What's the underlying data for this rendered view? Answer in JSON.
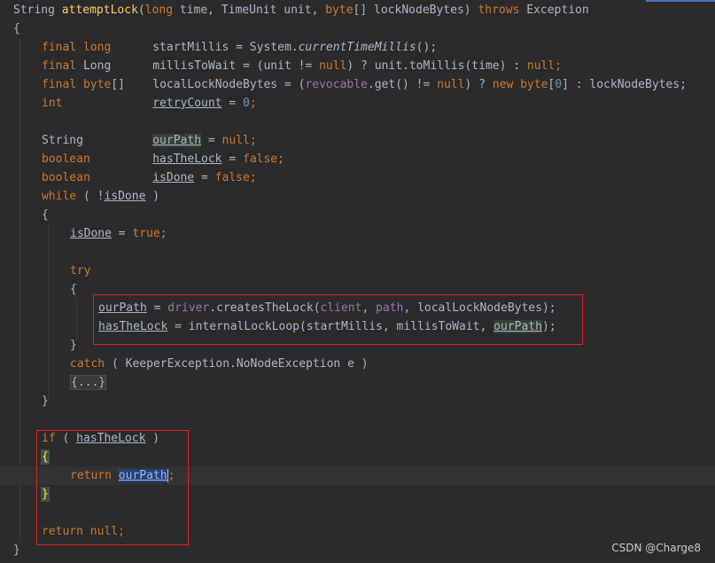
{
  "lines": [
    {
      "indent": 0,
      "tokens": [
        [
          "String ",
          "id"
        ],
        [
          "attemptLock",
          "fn"
        ],
        [
          "(",
          "id"
        ],
        [
          "long ",
          "kw"
        ],
        [
          "time, ",
          "id"
        ],
        [
          "TimeUnit unit, ",
          "id"
        ],
        [
          "byte",
          "kw"
        ],
        [
          "[] lockNodeBytes) ",
          "id"
        ],
        [
          "throws ",
          "kw"
        ],
        [
          "Exception",
          "id"
        ]
      ]
    },
    {
      "indent": 0,
      "tokens": [
        [
          "{",
          "id"
        ]
      ]
    },
    {
      "indent": 1,
      "tokens": [
        [
          "final long      ",
          "kw"
        ],
        [
          "startMillis = System.",
          "id"
        ],
        [
          "currentTimeMillis",
          "id italic"
        ],
        [
          "();",
          "id"
        ]
      ]
    },
    {
      "indent": 1,
      "tokens": [
        [
          "final ",
          "kw"
        ],
        [
          "Long      ",
          "id"
        ],
        [
          "millisToWait = (unit != ",
          "id"
        ],
        [
          "null",
          "kw"
        ],
        [
          ") ? unit.toMillis(time) : ",
          "id"
        ],
        [
          "null",
          "kw"
        ],
        [
          ";",
          "kw"
        ]
      ]
    },
    {
      "indent": 1,
      "tokens": [
        [
          "final ",
          "kw"
        ],
        [
          "byte",
          "kw"
        ],
        [
          "[]    ",
          "id"
        ],
        [
          "localLockNodeBytes = (",
          "id"
        ],
        [
          "revocable",
          "field"
        ],
        [
          ".get() != ",
          "id"
        ],
        [
          "null",
          "kw"
        ],
        [
          ") ? ",
          "id"
        ],
        [
          "new ",
          "kw"
        ],
        [
          "byte",
          "kw"
        ],
        [
          "[",
          "id"
        ],
        [
          "0",
          "num"
        ],
        [
          "] : lockNodeBytes;",
          "id"
        ]
      ]
    },
    {
      "indent": 1,
      "tokens": [
        [
          "int             ",
          "kw"
        ],
        [
          "retryCount",
          "id ul"
        ],
        [
          " = ",
          "id"
        ],
        [
          "0",
          "num"
        ],
        [
          ";",
          "kw"
        ]
      ]
    },
    {
      "indent": 0,
      "tokens": []
    },
    {
      "indent": 1,
      "tokens": [
        [
          "String          ",
          "id"
        ],
        [
          "ourPath",
          "id ul hl"
        ],
        [
          " = ",
          "id"
        ],
        [
          "null",
          "kw"
        ],
        [
          ";",
          "kw"
        ]
      ]
    },
    {
      "indent": 1,
      "tokens": [
        [
          "boolean         ",
          "kw"
        ],
        [
          "hasTheLock",
          "id ul"
        ],
        [
          " = ",
          "id"
        ],
        [
          "false",
          "kw"
        ],
        [
          ";",
          "kw"
        ]
      ]
    },
    {
      "indent": 1,
      "tokens": [
        [
          "boolean         ",
          "kw"
        ],
        [
          "isDone",
          "id ul"
        ],
        [
          " = ",
          "id"
        ],
        [
          "false",
          "kw"
        ],
        [
          ";",
          "kw"
        ]
      ]
    },
    {
      "indent": 1,
      "tokens": [
        [
          "while ",
          "kw"
        ],
        [
          "( !",
          "id"
        ],
        [
          "isDone",
          "id ul"
        ],
        [
          " )",
          "id"
        ]
      ]
    },
    {
      "indent": 1,
      "tokens": [
        [
          "{",
          "id"
        ]
      ]
    },
    {
      "indent": 2,
      "tokens": [
        [
          "isDone",
          "id ul"
        ],
        [
          " = ",
          "id"
        ],
        [
          "true",
          "kw"
        ],
        [
          ";",
          "kw"
        ]
      ]
    },
    {
      "indent": 0,
      "tokens": []
    },
    {
      "indent": 2,
      "tokens": [
        [
          "try",
          "kw"
        ]
      ]
    },
    {
      "indent": 2,
      "tokens": [
        [
          "{",
          "id"
        ]
      ]
    },
    {
      "indent": 3,
      "tokens": [
        [
          "ourPath",
          "id ul"
        ],
        [
          " = ",
          "id"
        ],
        [
          "driver",
          "field"
        ],
        [
          ".createsTheLock(",
          "id"
        ],
        [
          "client",
          "field"
        ],
        [
          ", ",
          "id"
        ],
        [
          "path",
          "field"
        ],
        [
          ", localLockNodeBytes);",
          "id"
        ]
      ]
    },
    {
      "indent": 3,
      "tokens": [
        [
          "hasTheLock",
          "id ul"
        ],
        [
          " = internalLockLoop(startMillis, millisToWait, ",
          "id"
        ],
        [
          "ourPath",
          "id ul hl"
        ],
        [
          ");",
          "id"
        ]
      ]
    },
    {
      "indent": 2,
      "tokens": [
        [
          "}",
          "id"
        ]
      ]
    },
    {
      "indent": 2,
      "tokens": [
        [
          "catch ",
          "kw"
        ],
        [
          "( KeeperException.NoNodeException e )",
          "id"
        ]
      ]
    },
    {
      "indent": 2,
      "tokens": [
        [
          "{...}",
          "fold"
        ]
      ]
    },
    {
      "indent": 1,
      "tokens": [
        [
          "}",
          "id"
        ]
      ]
    },
    {
      "indent": 0,
      "tokens": []
    },
    {
      "indent": 1,
      "tokens": [
        [
          "if ",
          "kw"
        ],
        [
          "( ",
          "id"
        ],
        [
          "hasTheLock",
          "id ul"
        ],
        [
          " )",
          "id"
        ]
      ]
    },
    {
      "indent": 1,
      "tokens": [
        [
          "{",
          "brace-match"
        ]
      ]
    },
    {
      "indent": 2,
      "current": true,
      "tokens": [
        [
          "return ",
          "kw"
        ],
        [
          "ourPath",
          "id ul sel"
        ],
        [
          "|",
          "caret"
        ],
        [
          ";",
          "kw"
        ]
      ]
    },
    {
      "indent": 1,
      "tokens": [
        [
          "}",
          "brace-match"
        ]
      ]
    },
    {
      "indent": 0,
      "tokens": []
    },
    {
      "indent": 1,
      "tokens": [
        [
          "return ",
          "kw"
        ],
        [
          "null",
          "kw"
        ],
        [
          ";",
          "kw"
        ]
      ]
    },
    {
      "indent": 0,
      "tokens": [
        [
          "}",
          "id"
        ]
      ]
    }
  ],
  "watermark": "CSDN @Charge8"
}
